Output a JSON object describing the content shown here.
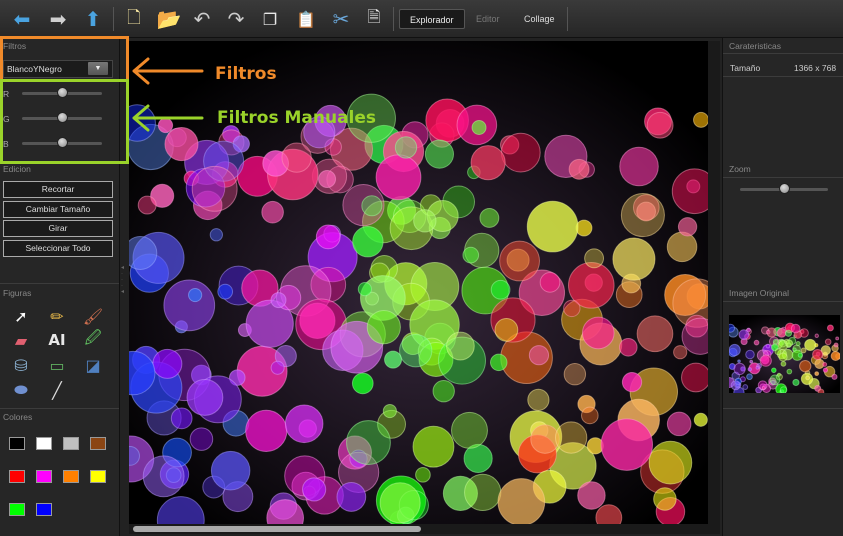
{
  "toolbar": {
    "tabs": [
      {
        "label": "Explorador",
        "active": true
      },
      {
        "label": "Editor",
        "active": false
      },
      {
        "label": "Collage",
        "active": false
      }
    ],
    "icons": [
      "back-arrow-icon",
      "forward-arrow-icon",
      "up-arrow-icon",
      "new-file-icon",
      "open-folder-icon",
      "undo-icon",
      "redo-icon",
      "copy-icon",
      "paste-icon",
      "cut-icon",
      "document-icon"
    ]
  },
  "left_panel": {
    "filtros": {
      "title": "Filtros",
      "selected": "BlancoYNegro",
      "sliders": [
        {
          "label": "R",
          "value": 0.5
        },
        {
          "label": "G",
          "value": 0.5
        },
        {
          "label": "B",
          "value": 0.5
        }
      ]
    },
    "edicion": {
      "title": "Edicion",
      "buttons": [
        "Recortar",
        "Cambiar Tamaño",
        "Girar",
        "Seleccionar Todo"
      ]
    },
    "figuras": {
      "title": "Figuras",
      "tools": [
        "pointer-icon",
        "pencil-icon",
        "brush-icon",
        "eraser-icon",
        "text-tool-icon",
        "eyedropper-icon",
        "paint-bucket-icon",
        "rectangle-icon",
        "gradient-icon",
        "ellipse-icon",
        "line-icon"
      ],
      "text_tool_label": "AI"
    },
    "colores": {
      "title": "Colores",
      "swatches": [
        "#000000",
        "#ffffff",
        "#c0c0c0",
        "#8b4513",
        "#ff0000",
        "#ff00ff",
        "#ff8000",
        "#ffff00",
        "#00ff00",
        "#0000ff"
      ]
    }
  },
  "right_panel": {
    "caracteristicas": {
      "title": "Carateristicas",
      "label": "Tamaño",
      "value": "1366 x 768"
    },
    "zoom": {
      "title": "Zoom",
      "value": 0.5
    },
    "original": {
      "title": "Imagen Original"
    }
  },
  "annotations": {
    "filtros_label": "Filtros",
    "manuales_label": "Filtros Manuales",
    "filtros_color": "#f08a2a",
    "manuales_color": "#9ad32a"
  },
  "canvas": {
    "scroll_fraction": 0.5
  }
}
